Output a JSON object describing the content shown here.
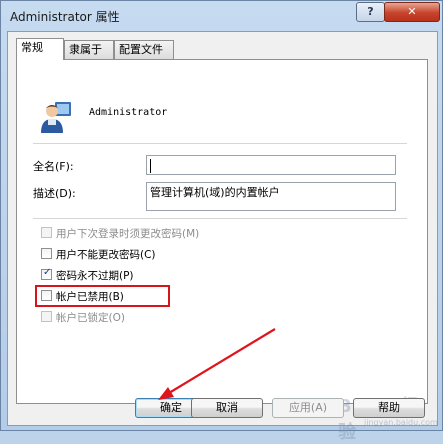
{
  "window": {
    "title": "Administrator 属性",
    "help_label": "?",
    "close_label": "✕"
  },
  "tabs": [
    {
      "label": "常规",
      "active": true
    },
    {
      "label": "隶属于",
      "active": false
    },
    {
      "label": "配置文件",
      "active": false
    }
  ],
  "user": {
    "name": "Administrator",
    "avatar_icon": "user-avatar-icon"
  },
  "fields": {
    "fullname_label": "全名(F):",
    "fullname_value": "",
    "description_label": "描述(D):",
    "description_value": "管理计算机(域)的内置帐户"
  },
  "checkboxes": [
    {
      "label": "用户下次登录时须更改密码(M)",
      "checked": false,
      "enabled": false
    },
    {
      "label": "用户不能更改密码(C)",
      "checked": false,
      "enabled": true
    },
    {
      "label": "密码永不过期(P)",
      "checked": true,
      "enabled": true
    },
    {
      "label": "帐户已禁用(B)",
      "checked": false,
      "enabled": true,
      "highlighted": true
    },
    {
      "label": "帐户已锁定(O)",
      "checked": false,
      "enabled": false
    }
  ],
  "buttons": {
    "ok": "确定",
    "cancel": "取消",
    "apply": "应用(A)",
    "help": "帮助"
  },
  "watermark": {
    "text": "Baidu经验",
    "url": "jingyan.baidu.com"
  },
  "colors": {
    "highlight_box": "#d8141b",
    "arrow": "#e0141b"
  }
}
